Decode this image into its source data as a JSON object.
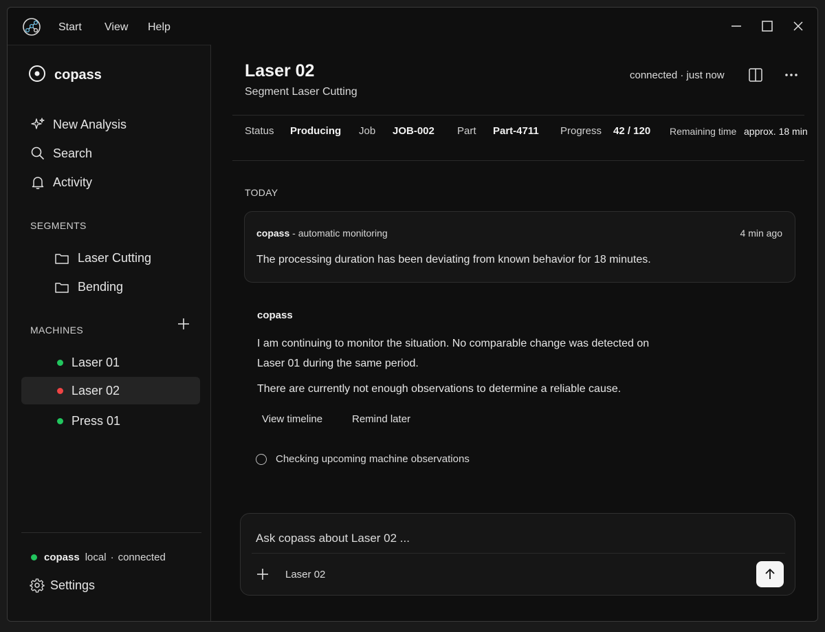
{
  "menu": {
    "start": "Start",
    "view": "View",
    "help": "Help"
  },
  "sidebar": {
    "brand": "copass",
    "nav": [
      {
        "label": "New Analysis",
        "icon": "sparkle-icon"
      },
      {
        "label": "Search",
        "icon": "search-icon"
      },
      {
        "label": "Activity",
        "icon": "bell-icon"
      }
    ],
    "segments_label": "SEGMENTS",
    "segments": [
      {
        "label": "Laser Cutting",
        "icon": "folder-icon"
      },
      {
        "label": "Bending",
        "icon": "folder-icon"
      }
    ],
    "machines_label": "MACHINES",
    "machines": [
      {
        "label": "Laser 01",
        "status": "ok",
        "color": "#22c55e"
      },
      {
        "label": "Laser 02",
        "status": "alert",
        "color": "#ef4444",
        "active": true
      },
      {
        "label": "Press 01",
        "status": "ok",
        "color": "#22c55e"
      }
    ],
    "connection": {
      "name": "copass",
      "mode": "local",
      "separator": "·",
      "state": "connected",
      "color": "#22c55e"
    },
    "settings_label": "Settings"
  },
  "header": {
    "title": "Laser 02",
    "subtitle": "Segment Laser Cutting",
    "connection": "connected · just now"
  },
  "status_bar": {
    "status_label": "Status",
    "status_value": "Producing",
    "job_label": "Job",
    "job_value": "JOB-002",
    "part_label": "Part",
    "part_value": "Part-4711",
    "progress_label": "Progress",
    "progress_value": "42 / 120",
    "remaining_label": "Remaining time",
    "remaining_value": "approx. 18 min"
  },
  "feed": {
    "day_label": "TODAY",
    "alert": {
      "author": "copass",
      "source": " - automatic monitoring",
      "time": "4 min ago",
      "text": "The processing duration has been deviating from known behavior for 18 minutes."
    },
    "reply": {
      "author": "copass",
      "line1": "I am continuing to monitor the situation. No comparable change was detected on",
      "line2": "Laser 01 during the same period.",
      "line3": "There are currently not enough observations to determine a reliable cause."
    },
    "actions": {
      "timeline": "View timeline",
      "remind": "Remind later"
    },
    "task": "Checking upcoming machine observations"
  },
  "composer": {
    "placeholder": "Ask copass about Laser 02 ...",
    "context": "Laser 02"
  }
}
